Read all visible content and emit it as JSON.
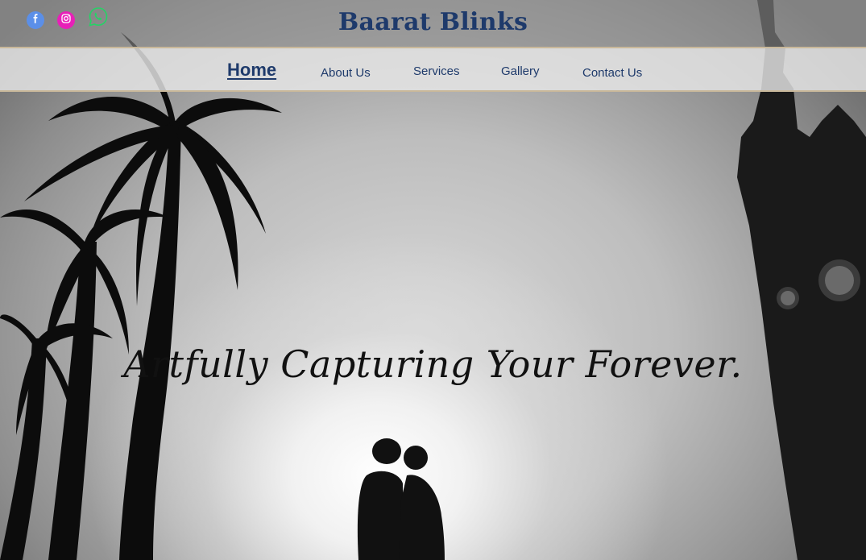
{
  "social": {
    "facebook_icon": "facebook-icon",
    "instagram_icon": "instagram-icon",
    "whatsapp_icon": "whatsapp-icon",
    "facebook_color": "#5b8fe8",
    "instagram_color": "#e820b8",
    "whatsapp_color": "#25d366"
  },
  "header": {
    "brand": "Baarat Blinks",
    "brand_color": "#1e3a6b"
  },
  "nav": {
    "items": [
      {
        "label": "Home"
      },
      {
        "label": "About Us"
      },
      {
        "label": "Services"
      },
      {
        "label": "Gallery"
      },
      {
        "label": "Contact Us"
      }
    ],
    "active": "Home"
  },
  "hero": {
    "tagline": "Artfully Capturing Your Forever."
  }
}
